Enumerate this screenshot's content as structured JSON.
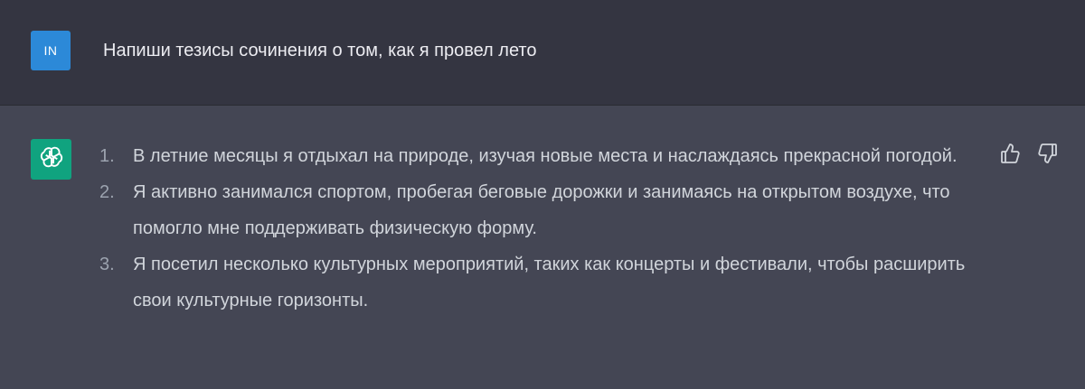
{
  "user": {
    "avatar_initials": "IN",
    "avatar_color": "#2c89d8",
    "message": "Напиши тезисы сочинения о том, как я провел лето"
  },
  "assistant": {
    "avatar_icon": "openai-logo-icon",
    "avatar_color": "#10a37f",
    "items": [
      {
        "number": "1.",
        "text": "В летние месяцы я отдыхал на природе, изучая новые места и наслаждаясь прекрасной погодой."
      },
      {
        "number": "2.",
        "text": "Я активно занимался спортом, пробегая беговые дорожки и занимаясь на открытом воздухе, что помогло мне поддерживать физическую форму."
      },
      {
        "number": "3.",
        "text": "Я посетил несколько культурных мероприятий, таких как концерты и фестивали, чтобы расширить свои культурные горизонты."
      }
    ],
    "feedback_icons": [
      "thumbs-up-icon",
      "thumbs-down-icon"
    ]
  },
  "colors": {
    "user_background": "#343541",
    "assistant_background": "#444654",
    "text": "#d1d5db"
  }
}
